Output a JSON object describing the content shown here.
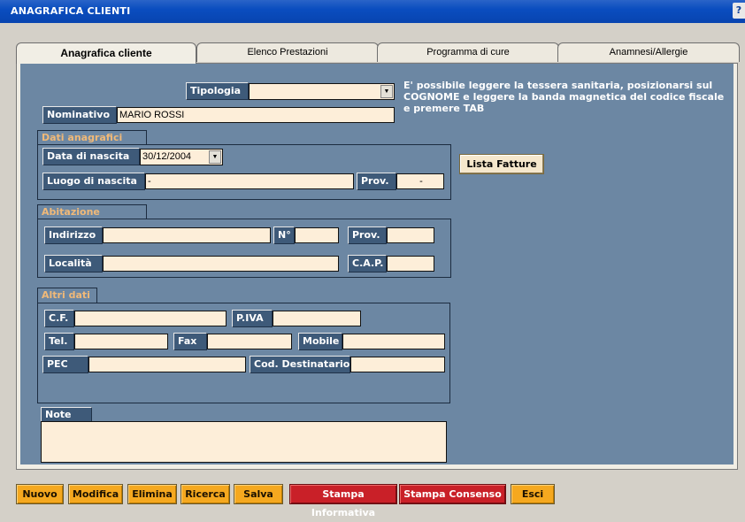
{
  "window": {
    "title": "ANAGRAFICA CLIENTI",
    "help": "?"
  },
  "tabs": [
    {
      "label": "Anagrafica cliente",
      "active": true
    },
    {
      "label": "Elenco Prestazioni"
    },
    {
      "label": "Programma di cure"
    },
    {
      "label": "Anamnesi/Allergie"
    }
  ],
  "hint": "E' possibile leggere la tessera sanitaria, posizionarsi sul COGNOME e leggere la banda magnetica del codice fiscale e premere TAB",
  "form": {
    "tipologia": {
      "label": "Tipologia",
      "value": ""
    },
    "nominativo": {
      "label": "Nominativo",
      "value": "MARIO ROSSI"
    },
    "dati_anagrafici": {
      "title": "Dati anagrafici",
      "data_nascita": {
        "label": "Data di nascita",
        "value": "30/12/2004"
      },
      "luogo_nascita": {
        "label": "Luogo di nascita",
        "value": "-"
      },
      "prov": {
        "label": "Prov.",
        "value": "-"
      }
    },
    "abitazione": {
      "title": "Abitazione",
      "indirizzo": {
        "label": "Indirizzo",
        "value": ""
      },
      "numero": {
        "label": "N°",
        "value": ""
      },
      "prov": {
        "label": "Prov.",
        "value": ""
      },
      "localita": {
        "label": "Località",
        "value": ""
      },
      "cap": {
        "label": "C.A.P.",
        "value": ""
      }
    },
    "altri_dati": {
      "title": "Altri dati",
      "cf": {
        "label": "C.F.",
        "value": ""
      },
      "piva": {
        "label": "P.IVA",
        "value": ""
      },
      "tel": {
        "label": "Tel.",
        "value": ""
      },
      "fax": {
        "label": "Fax",
        "value": ""
      },
      "mobile": {
        "label": "Mobile",
        "value": ""
      },
      "pec": {
        "label": "PEC",
        "value": ""
      },
      "cod_destinatario": {
        "label": "Cod. Destinatario",
        "value": ""
      }
    },
    "note": {
      "label": "Note",
      "value": ""
    }
  },
  "lista_fatture": "Lista Fatture",
  "buttons": {
    "nuovo": "Nuovo",
    "modifica": "Modifica",
    "elimina": "Elimina",
    "ricerca": "Ricerca",
    "salva": "Salva",
    "stampa_informativa": "Stampa Informativa",
    "stampa_consenso": "Stampa Consenso",
    "esci": "Esci"
  },
  "colors": {
    "panel_blue": "#6c87a3",
    "label_navy": "#3e5a79",
    "field_bg": "#fdeed9",
    "group_title": "#f0b978",
    "btn_orange": "#f5a81f",
    "btn_red": "#c92028"
  }
}
